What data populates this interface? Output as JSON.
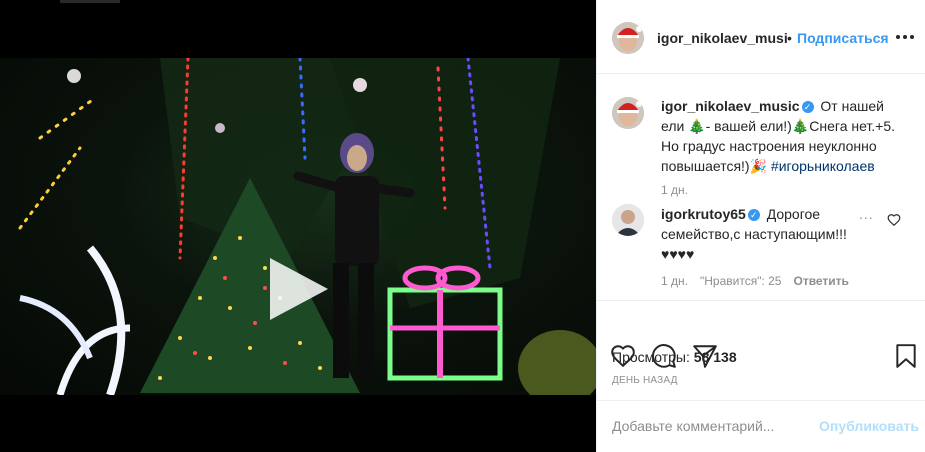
{
  "header": {
    "username": "igor_nikolaev_musi",
    "separator": "•",
    "follow_label": "Подписаться"
  },
  "caption": {
    "username": "igor_nikolaev_music",
    "verified_glyph": "✓",
    "text": "От нашей ели 🎄- вашей ели!)🎄Снега нет.+5. Но градус настроения неуклонно повышается!)🎉",
    "hashtag": "#игорьниколаев",
    "time": "1 дн."
  },
  "comment1": {
    "username": "igorkrutoy65",
    "verified_glyph": "✓",
    "text": "Дорогое семейство,с наступающим!!! ♥♥♥♥",
    "more_label": "...",
    "time": "1 дн.",
    "likes": "\"Нравится\": 25",
    "reply_label": "Ответить"
  },
  "stats": {
    "views_label": "Просмотры:",
    "views_count": "58 138",
    "posted": "ДЕНЬ НАЗАД"
  },
  "add_comment": {
    "placeholder": "Добавьте комментарий...",
    "publish_label": "Опубликовать"
  },
  "icons": {
    "more": "more-horizontal-icon",
    "like": "heart-icon",
    "comment": "comment-bubble-icon",
    "share": "paper-plane-icon",
    "save": "bookmark-icon",
    "play": "play-icon"
  },
  "colors": {
    "accent": "#3897f0",
    "publish_disabled": "#b2dffc",
    "muted": "#8e8e8e",
    "text": "#262626"
  }
}
